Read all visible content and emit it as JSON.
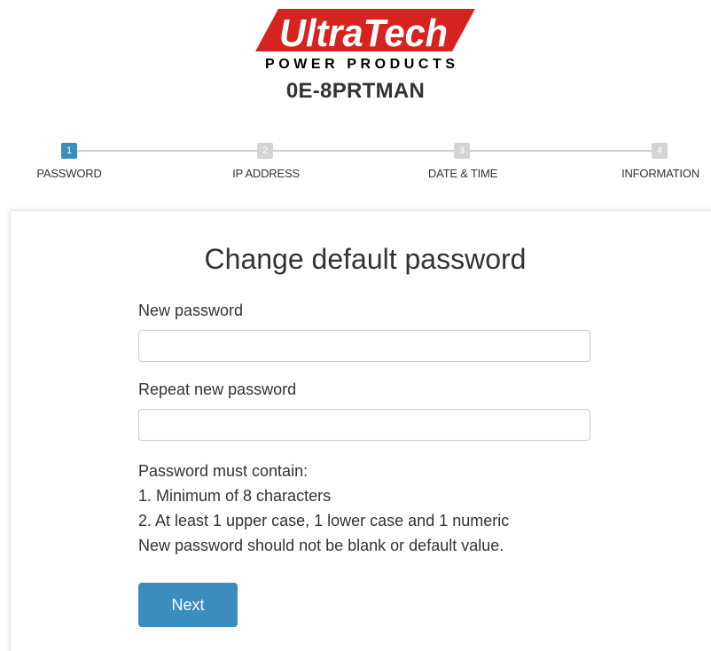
{
  "header": {
    "logo": {
      "brand_text": "UltraTech",
      "sub_text": "POWER PRODUCTS",
      "brand_color": "#d7231f"
    },
    "device_name": "0E-8PRTMAN"
  },
  "stepper": {
    "active_color": "#3b8dbd",
    "inactive_color": "#d4d4d4",
    "steps": [
      {
        "number": "1",
        "label": "PASSWORD",
        "active": true
      },
      {
        "number": "2",
        "label": "IP ADDRESS",
        "active": false
      },
      {
        "number": "3",
        "label": "DATE & TIME",
        "active": false
      },
      {
        "number": "4",
        "label": "INFORMATION",
        "active": false
      }
    ]
  },
  "form": {
    "title": "Change default password",
    "new_password": {
      "label": "New password",
      "value": "",
      "placeholder": ""
    },
    "repeat_password": {
      "label": "Repeat new password",
      "value": "",
      "placeholder": ""
    },
    "rules": [
      "Password must contain:",
      "1. Minimum of 8 characters",
      "2. At least 1 upper case, 1 lower case and 1 numeric",
      "New password should not be blank or default value."
    ],
    "next_button": {
      "label": "Next",
      "color": "#3b8dbd"
    }
  }
}
